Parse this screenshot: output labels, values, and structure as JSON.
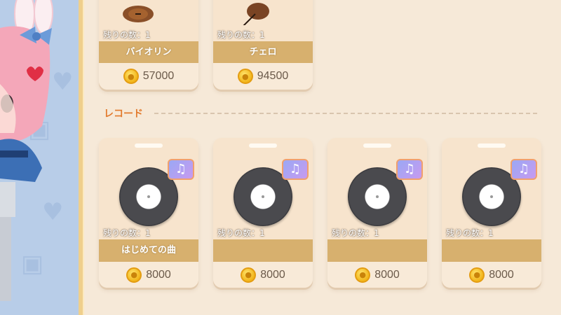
{
  "instruments": [
    {
      "remaining": "残りの数：1",
      "name": "バイオリン",
      "price": "57000",
      "icon": "violin-icon"
    },
    {
      "remaining": "残りの数：1",
      "name": "チェロ",
      "price": "94500",
      "icon": "cello-icon"
    }
  ],
  "records_section": {
    "title": "レコード"
  },
  "records": [
    {
      "remaining": "残りの数：1",
      "name": "はじめての曲",
      "price": "8000"
    },
    {
      "remaining": "残りの数：1",
      "name": "",
      "price": "8000"
    },
    {
      "remaining": "残りの数：1",
      "name": "",
      "price": "8000"
    },
    {
      "remaining": "残りの数：1",
      "name": "",
      "price": "8000"
    }
  ],
  "colors": {
    "panel_bg": "#f6e9d8",
    "band": "#d7b06e",
    "section_title": "#e27a2d",
    "left_bg": "#b8cde8"
  },
  "badge_icon": "music-note-icon",
  "coin_icon": "acorn-coin-icon"
}
